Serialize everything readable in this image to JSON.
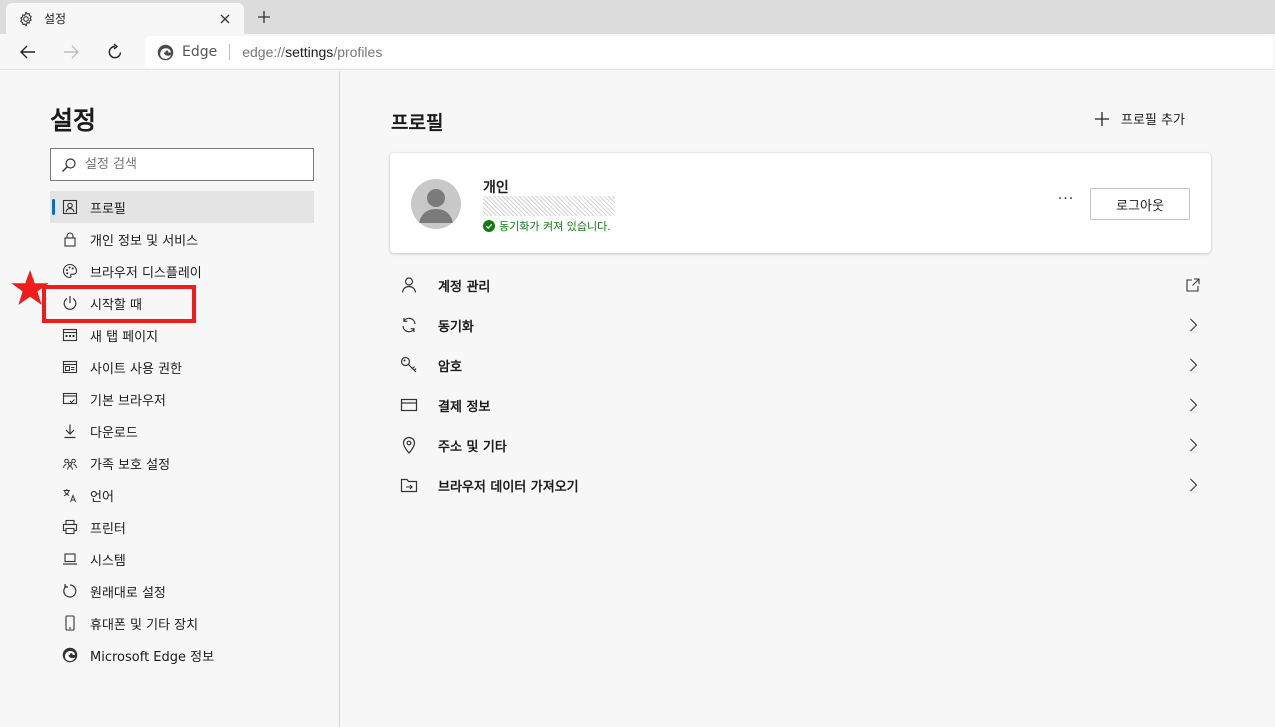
{
  "browser": {
    "tab_title": "설정",
    "site_name": "Edge",
    "url_scheme": "edge://",
    "url_host": "settings",
    "url_path": "/profiles"
  },
  "sidebar": {
    "title": "설정",
    "search_placeholder": "설정 검색",
    "items": [
      {
        "label": "프로필",
        "icon": "profile-icon",
        "active": true
      },
      {
        "label": "개인 정보 및 서비스",
        "icon": "lock-icon"
      },
      {
        "label": "브라우저 디스플레이",
        "icon": "palette-icon"
      },
      {
        "label": "시작할 때",
        "icon": "power-icon"
      },
      {
        "label": "새 탭 페이지",
        "icon": "new-tab-page-icon"
      },
      {
        "label": "사이트 사용 권한",
        "icon": "site-permissions-icon"
      },
      {
        "label": "기본 브라우저",
        "icon": "default-browser-icon"
      },
      {
        "label": "다운로드",
        "icon": "download-icon"
      },
      {
        "label": "가족 보호 설정",
        "icon": "family-icon"
      },
      {
        "label": "언어",
        "icon": "language-icon"
      },
      {
        "label": "프린터",
        "icon": "printer-icon"
      },
      {
        "label": "시스템",
        "icon": "laptop-icon"
      },
      {
        "label": "원래대로 설정",
        "icon": "reset-icon"
      },
      {
        "label": "휴대폰 및 기타 장치",
        "icon": "phone-icon"
      },
      {
        "label": "Microsoft Edge 정보",
        "icon": "edge-logo-icon"
      }
    ]
  },
  "main": {
    "title": "프로필",
    "add_profile_label": "프로필 추가",
    "profile": {
      "name": "개인",
      "sync_status": "동기화가 켜져 있습니다.",
      "more_label": "···",
      "logout_label": "로그아웃"
    },
    "rows": [
      {
        "label": "계정 관리",
        "icon": "person-icon",
        "trail": "external-link-icon"
      },
      {
        "label": "동기화",
        "icon": "sync-icon",
        "trail": "chevron-right-icon"
      },
      {
        "label": "암호",
        "icon": "key-icon",
        "trail": "chevron-right-icon"
      },
      {
        "label": "결제 정보",
        "icon": "credit-card-icon",
        "trail": "chevron-right-icon"
      },
      {
        "label": "주소 및 기타",
        "icon": "location-pin-icon",
        "trail": "chevron-right-icon"
      },
      {
        "label": "브라우저 데이터 가져오기",
        "icon": "import-folder-icon",
        "trail": "chevron-right-icon"
      }
    ]
  },
  "colors": {
    "accent": "#0f6cbd",
    "highlight": "#ee1c1c",
    "sync_green": "#107c10"
  }
}
